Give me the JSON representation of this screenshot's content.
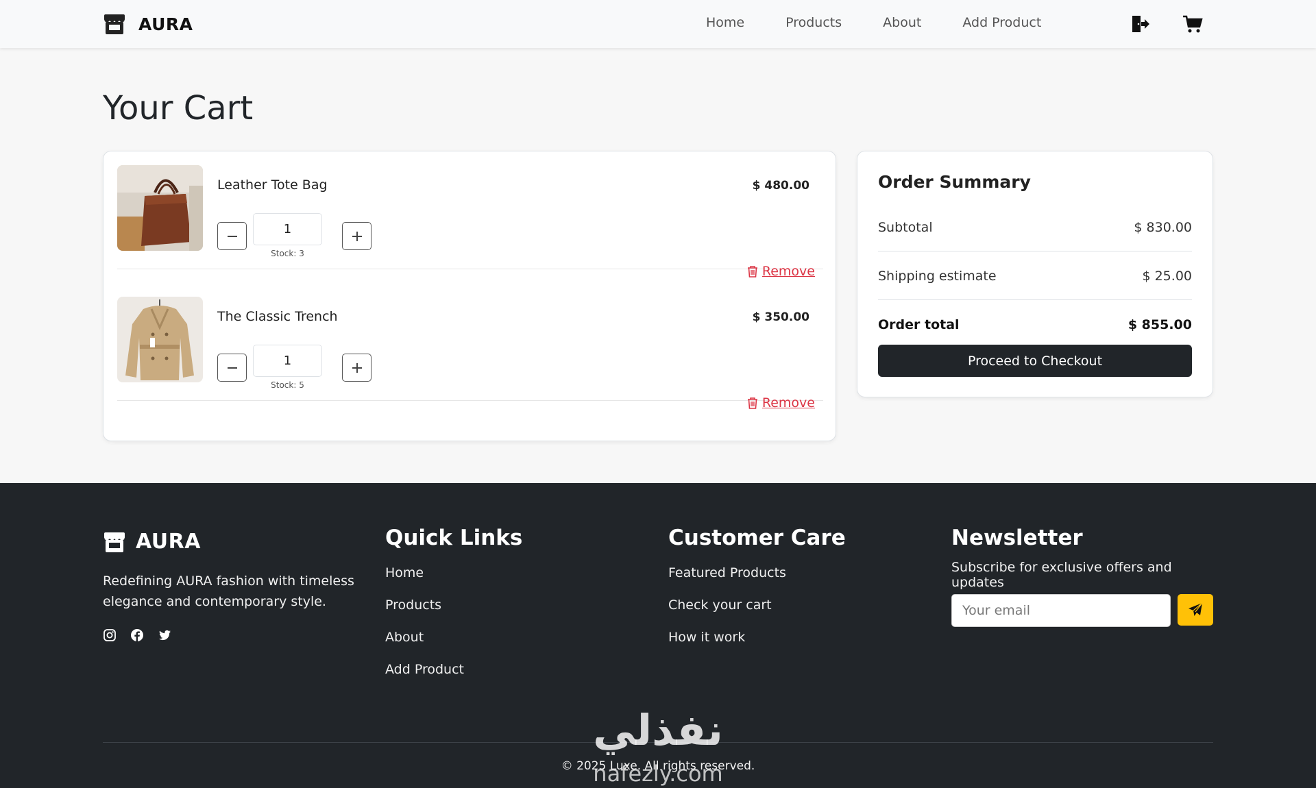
{
  "brand": {
    "name": "AURA"
  },
  "nav": {
    "links": [
      "Home",
      "Products",
      "About",
      "Add Product"
    ],
    "icons": [
      "logout-icon",
      "cart-icon"
    ]
  },
  "page": {
    "title": "Your Cart"
  },
  "cart": {
    "items": [
      {
        "name": "Leather Tote Bag",
        "price": "$ 480.00",
        "quantity": "1",
        "stock": "Stock: 3",
        "remove_label": "Remove"
      },
      {
        "name": "The Classic Trench",
        "price": "$ 350.00",
        "quantity": "1",
        "stock": "Stock: 5",
        "remove_label": "Remove"
      }
    ]
  },
  "summary": {
    "title": "Order Summary",
    "subtotal_label": "Subtotal",
    "subtotal_value": "$ 830.00",
    "shipping_label": "Shipping estimate",
    "shipping_value": "$ 25.00",
    "total_label": "Order total",
    "total_value": "$ 855.00",
    "checkout_label": "Proceed to Checkout"
  },
  "footer": {
    "brand": "AURA",
    "description": "Redefining AURA fashion with timeless elegance and contemporary style.",
    "social_icons": [
      "instagram-icon",
      "facebook-icon",
      "twitter-icon"
    ],
    "quick_links": {
      "title": "Quick Links",
      "links": [
        "Home",
        "Products",
        "About",
        "Add Product"
      ]
    },
    "customer_care": {
      "title": "Customer Care",
      "links": [
        "Featured Products",
        "Check your cart",
        "How it work"
      ]
    },
    "newsletter": {
      "title": "Newsletter",
      "subtitle": "Subscribe for exclusive offers and updates",
      "email_placeholder": "Your email"
    },
    "copyright": "© 2025 Luxe. All rights reserved."
  },
  "watermark": {
    "arabic": "نفذلي",
    "latin": "nafezly.com"
  },
  "colors": {
    "dark": "#212529",
    "danger": "#dc3545",
    "accent": "#ffc107",
    "navbar_bg": "#f8f9fa"
  }
}
